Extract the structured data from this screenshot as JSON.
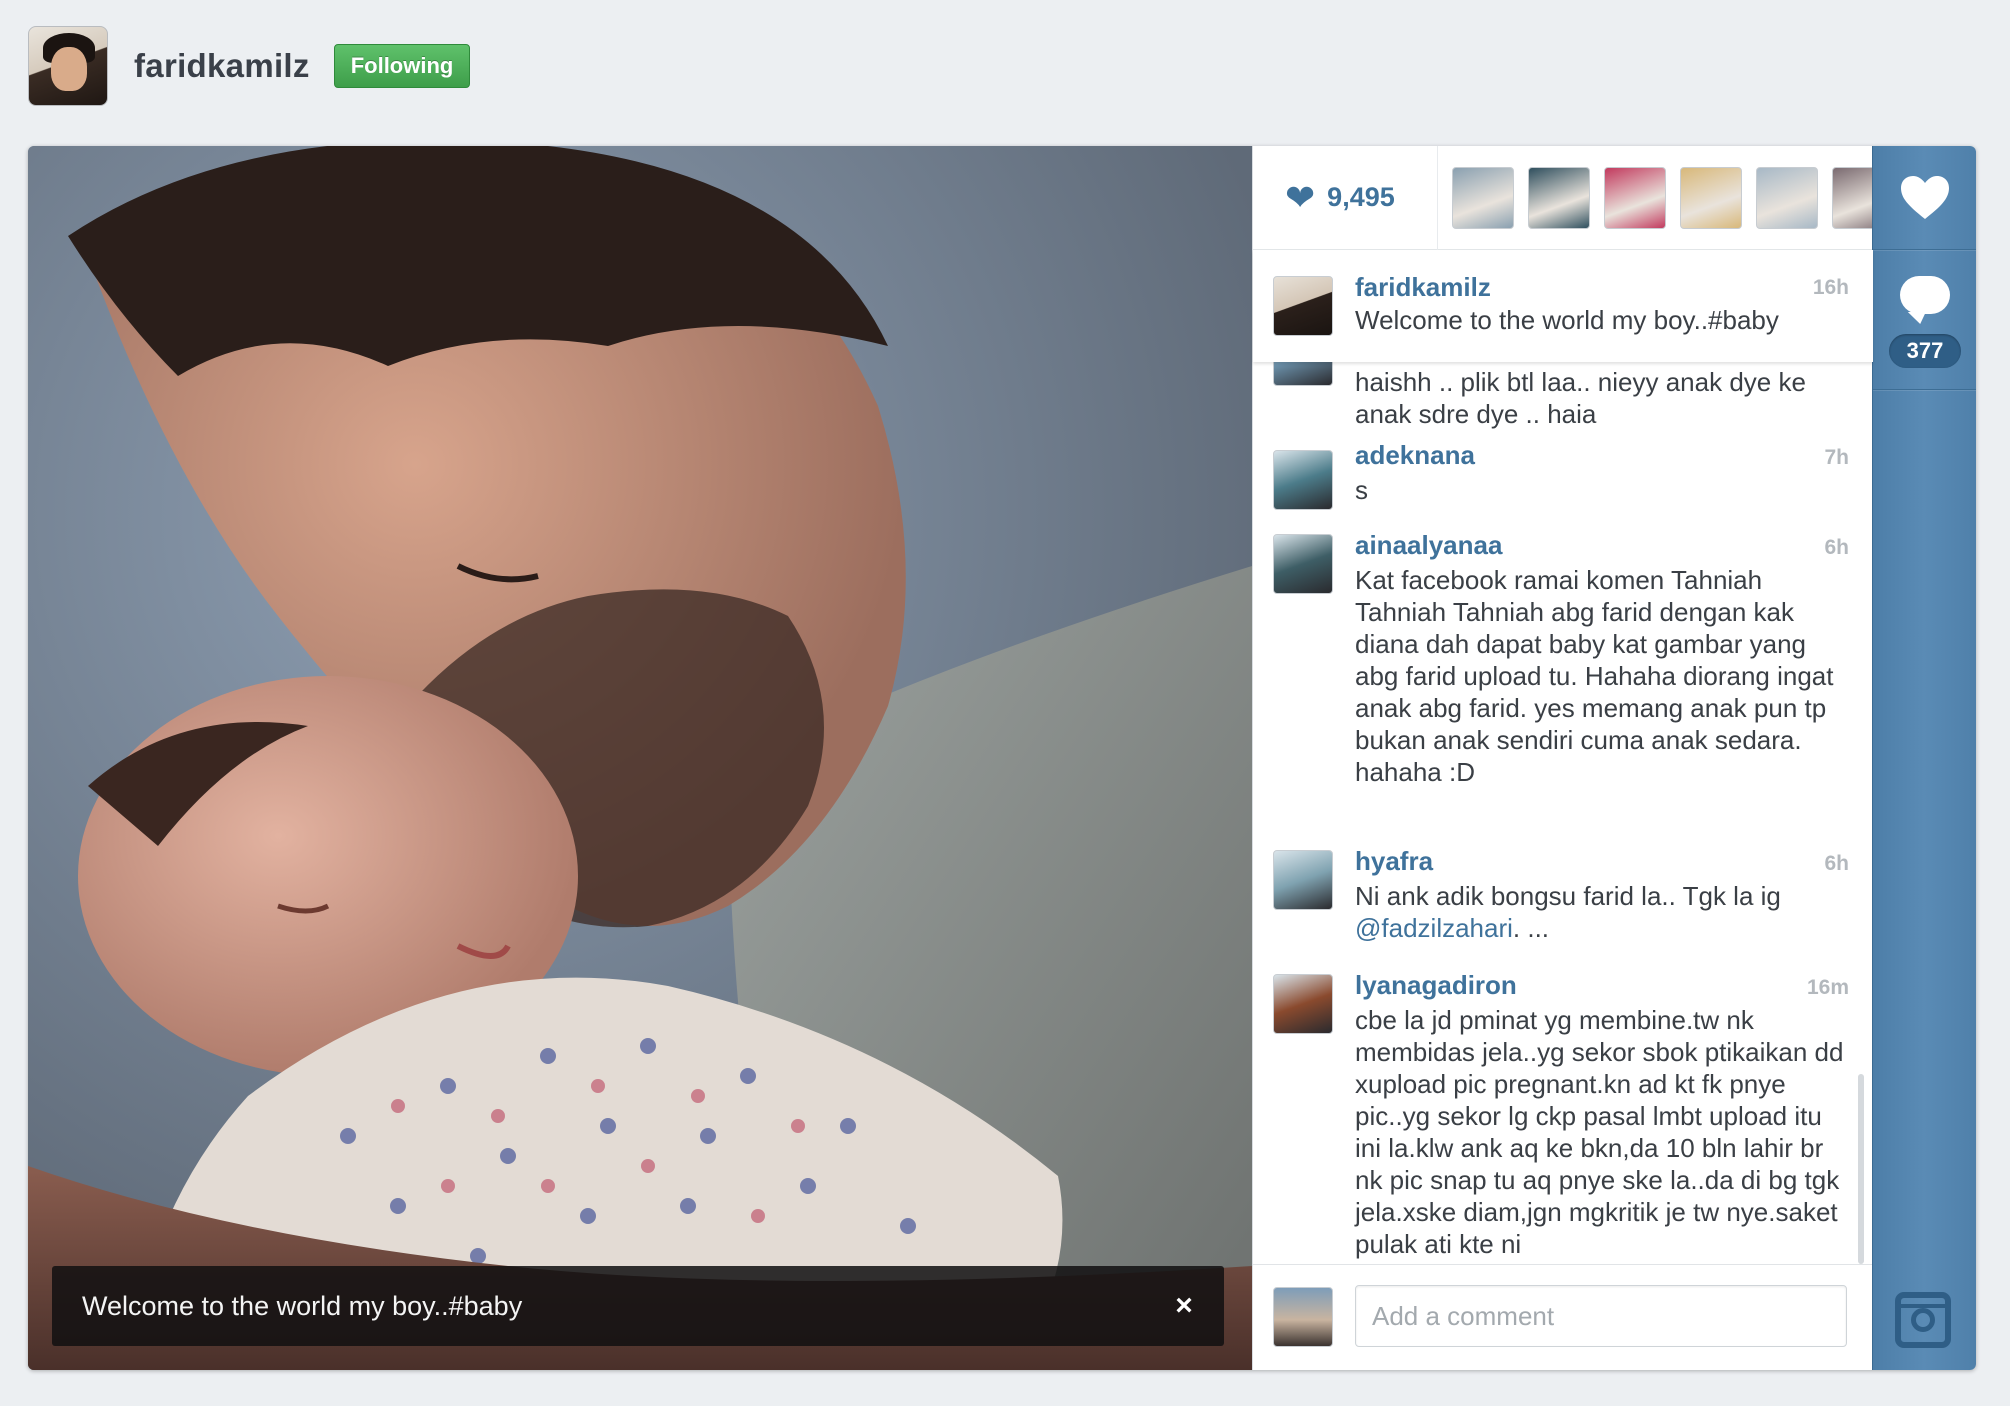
{
  "owner": {
    "username": "faridkamilz",
    "follow_label": "Following"
  },
  "photo": {
    "caption": "Welcome to the world my boy..#baby",
    "close_label": "×"
  },
  "likes": {
    "count": "9,495",
    "likers": [
      "#8aa0b0",
      "#2f4f5e",
      "#c23a5e",
      "#d8b87a",
      "#a7b8c6",
      "#7a6a70"
    ]
  },
  "caption_comment": {
    "user": "faridkamilz",
    "time": "16h",
    "text": "Welcome to the world my boy..#baby"
  },
  "comments": [
    {
      "user": "",
      "time": "",
      "text": "haishh .. plik btl laa.. nieyy anak dye ke anak sdre dye .. haia",
      "avatar": "#6a8fa8"
    },
    {
      "user": "adeknana",
      "time": "7h",
      "text": "s",
      "avatar": "#4c7c8a"
    },
    {
      "user": "ainaalyanaa",
      "time": "6h",
      "text": "Kat facebook ramai komen Tahniah Tahniah Tahniah abg farid dengan kak diana dah dapat baby kat gambar yang abg farid upload tu. Hahaha diorang ingat anak abg farid. yes memang anak pun tp bukan anak sendiri cuma anak sedara. hahaha :D",
      "avatar": "#3e5e66"
    },
    {
      "user": "hyafra",
      "time": "6h",
      "text_before": "Ni ank adik bongsu farid la.. Tgk la ig ",
      "mention": "@fadzilzahari",
      "text_after": ". ...",
      "avatar": "#7fa2b0"
    },
    {
      "user": "lyanagadiron",
      "time": "16m",
      "text": "cbe la jd pminat yg membine.tw nk membidas jela..yg sekor sbok ptikaikan dd xupload pic pregnant.kn ad kt fk pnye pic..yg sekor lg ckp pasal lmbt upload itu ini la.klw ank aq ke bkn,da 10 bln lahir br nk pic snap tu aq pnye ske la..da di bg tgk jela.xske diam,jgn mgkritik je tw nye.saket pulak ati kte ni",
      "avatar": "#8a4a2e"
    }
  ],
  "add_comment": {
    "placeholder": "Add a comment"
  },
  "rail": {
    "comment_count": "377"
  },
  "colors": {
    "accent": "#3f729b",
    "follow_green": "#4caf50",
    "rail_blue": "#517fa4"
  }
}
